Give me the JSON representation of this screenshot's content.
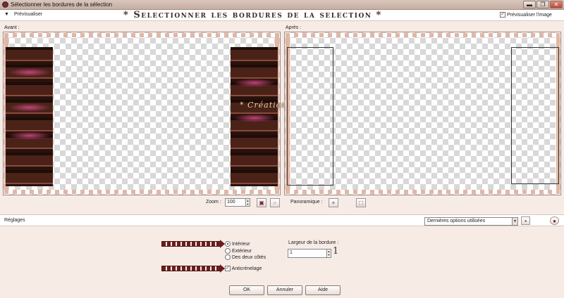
{
  "window": {
    "title": "Sélectionner les bordures de la sélection",
    "minimize": "▬",
    "maximize": "❐",
    "close": "✕"
  },
  "preview": {
    "toggle_label": "Prévisualiser",
    "banner": "* Selectionner les bordures de la selection *",
    "preview_image_label": "Prévisualiser l'image",
    "preview_image_checked": true
  },
  "panels": {
    "before_label": "Avant :",
    "after_label": "Après :",
    "watermark": "* Création Sweety *"
  },
  "zoom": {
    "label": "Zoom :",
    "value": "100",
    "panoramic_label": "Panoramique :"
  },
  "settings": {
    "label": "Réglages",
    "preset": "Dernières options utilisées"
  },
  "options": {
    "selected": "Intérieur",
    "items": [
      "Intérieur",
      "Extérieur",
      "Des deux côtés"
    ],
    "antialias_label": "Anticrénelage",
    "antialias_checked": true
  },
  "border": {
    "label": "Largeur de la bordure :",
    "value": "1",
    "annotation": "1"
  },
  "buttons": {
    "ok": "OK",
    "cancel": "Annuler",
    "help": "Aide"
  }
}
